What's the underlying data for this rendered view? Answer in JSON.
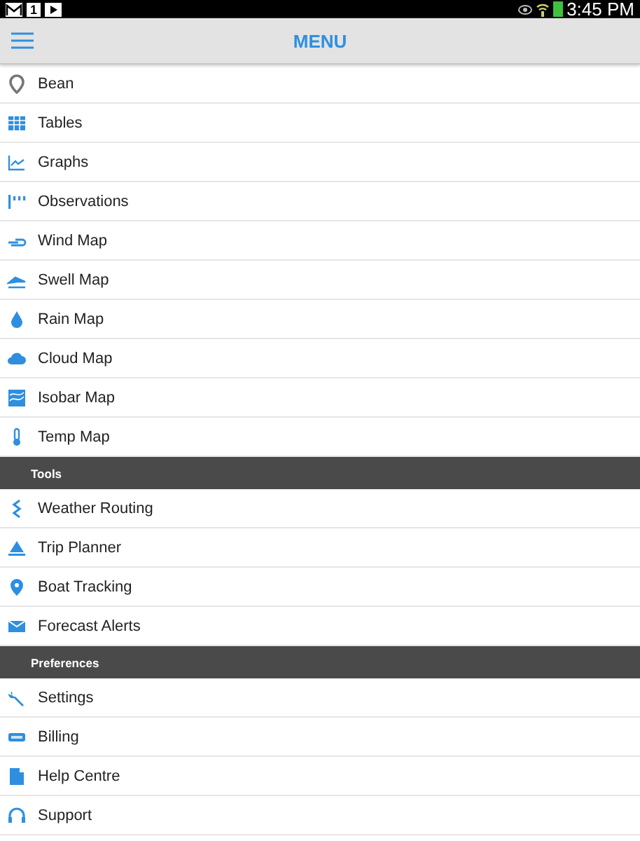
{
  "status_bar": {
    "calendar_date": "1",
    "time": "3:45 PM"
  },
  "header": {
    "title": "MENU"
  },
  "sections": [
    {
      "items": [
        {
          "label": "Bean"
        },
        {
          "label": "Tables"
        },
        {
          "label": "Graphs"
        },
        {
          "label": "Observations"
        },
        {
          "label": "Wind Map"
        },
        {
          "label": "Swell Map"
        },
        {
          "label": "Rain Map"
        },
        {
          "label": "Cloud Map"
        },
        {
          "label": "Isobar Map"
        },
        {
          "label": "Temp Map"
        }
      ]
    },
    {
      "title": "Tools",
      "items": [
        {
          "label": "Weather Routing"
        },
        {
          "label": "Trip Planner"
        },
        {
          "label": "Boat Tracking"
        },
        {
          "label": "Forecast Alerts"
        }
      ]
    },
    {
      "title": "Preferences",
      "items": [
        {
          "label": "Settings"
        },
        {
          "label": "Billing"
        },
        {
          "label": "Help Centre"
        },
        {
          "label": "Support"
        }
      ]
    }
  ]
}
